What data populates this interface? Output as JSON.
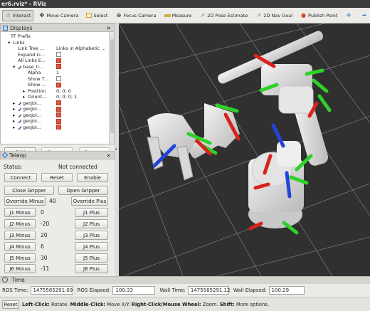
{
  "window": {
    "title": "er6.rviz* - RViz"
  },
  "toolbar": {
    "items": [
      {
        "label": "Interact",
        "icon": "cursor-icon"
      },
      {
        "label": "Move Camera",
        "icon": "move-camera-icon"
      },
      {
        "label": "Select",
        "icon": "select-icon"
      },
      {
        "label": "Focus Camera",
        "icon": "focus-camera-icon"
      },
      {
        "label": "Measure",
        "icon": "ruler-icon"
      },
      {
        "label": "2D Pose Estimate",
        "icon": "green-arrow-icon"
      },
      {
        "label": "2D Nav Goal",
        "icon": "green-arrow-icon"
      },
      {
        "label": "Publish Point",
        "icon": "map-pin-icon"
      }
    ],
    "accent_colors": {
      "pose": "#3aa34a",
      "pin": "#d9462a",
      "plus": "#2d6cb3"
    }
  },
  "displays": {
    "title": "Displays",
    "rows": [
      {
        "label": "TF Prefix",
        "value": ""
      },
      {
        "label": "Links",
        "value": ""
      },
      {
        "label": "Link Tree ...",
        "value": "Links in Alphabetic ..."
      },
      {
        "label": "Expand Li...",
        "value": ""
      },
      {
        "label": "All Links E...",
        "value": ""
      },
      {
        "label": "base_li...",
        "value": ""
      },
      {
        "label": "Alpha",
        "value": "1"
      },
      {
        "label": "Show T...",
        "value": ""
      },
      {
        "label": "Show ...",
        "value": ""
      },
      {
        "label": "Position",
        "value": "0; 0; 0"
      },
      {
        "label": "Orient...",
        "value": "0; 0; 0; 1"
      },
      {
        "label": "geoJoi...",
        "value": ""
      },
      {
        "label": "geoJoi...",
        "value": ""
      },
      {
        "label": "geoJoi...",
        "value": ""
      },
      {
        "label": "geoJoi...",
        "value": ""
      },
      {
        "label": "geoJoi...",
        "value": ""
      }
    ],
    "buttons": {
      "add": "Add",
      "remove": "Remove",
      "rename": "Rename"
    }
  },
  "teleop": {
    "title": "Teleop",
    "status_label": "Status:",
    "status_value": "Not connected",
    "connect": "Connect",
    "reset": "Reset",
    "enable": "Enable",
    "close_gripper": "Close Gripper",
    "open_gripper": "Open Gripper",
    "override_minus": "Override Minus",
    "override_value": "40",
    "override_plus": "Override Plus",
    "joints": [
      {
        "minus": "J1 Minus",
        "value": "0",
        "plus": "J1 Plus"
      },
      {
        "minus": "J2 Minus",
        "value": "-20",
        "plus": "J2 Plus"
      },
      {
        "minus": "J3 Minus",
        "value": "20",
        "plus": "J3 Plus"
      },
      {
        "minus": "J4 Minus",
        "value": "6",
        "plus": "J4 Plus"
      },
      {
        "minus": "J5 Minus",
        "value": "30",
        "plus": "J5 Plus"
      },
      {
        "minus": "J6 Minus",
        "value": "-11",
        "plus": "J6 Plus"
      }
    ]
  },
  "time": {
    "title": "Time",
    "ros_time_label": "ROS Time:",
    "ros_time": "1475585291.09",
    "ros_elapsed_label": "ROS Elapsed:",
    "ros_elapsed": "100.33",
    "wall_time_label": "Wall Time:",
    "wall_time": "1475585291.12",
    "wall_elapsed_label": "Wall Elapsed:",
    "wall_elapsed": "100.29"
  },
  "status": {
    "reset": "Reset",
    "left_click": "Left-Click:",
    "left_click_desc": " Rotate. ",
    "middle_click": "Middle-Click:",
    "middle_click_desc": " Move X/Y. ",
    "right_click": "Right-Click/Mouse Wheel:",
    "right_click_desc": " Zoom. ",
    "shift": "Shift:",
    "shift_desc": " More options."
  }
}
